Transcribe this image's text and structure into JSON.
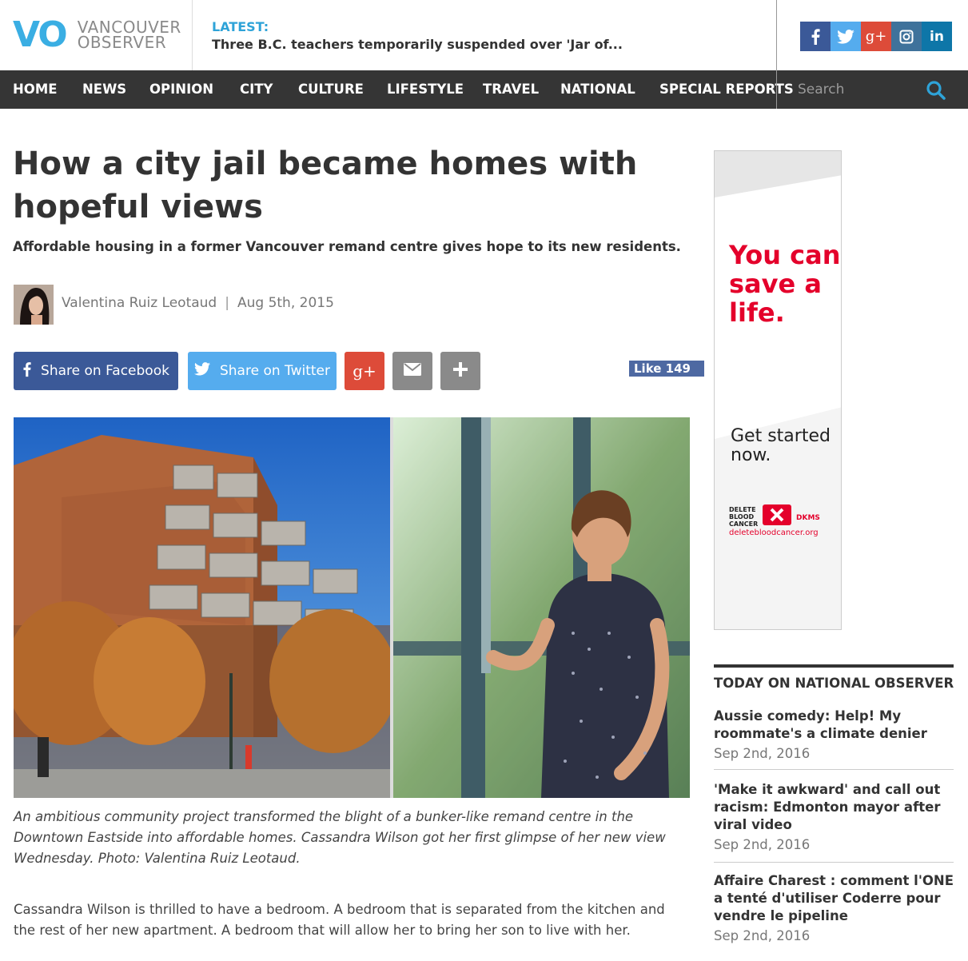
{
  "header": {
    "logo_mark": "VO",
    "logo_line1": "VANCOUVER",
    "logo_line2": "OBSERVER",
    "latest_label": "LATEST:",
    "latest_text": "Three B.C. teachers temporarily suspended over 'Jar of...",
    "social": [
      {
        "icon": "facebook-icon",
        "glyph": "f",
        "color": "#3b5998"
      },
      {
        "icon": "twitter-icon",
        "glyph": "t",
        "color": "#55acee"
      },
      {
        "icon": "google-plus-icon",
        "glyph": "g+",
        "color": "#dd4b39"
      },
      {
        "icon": "instagram-icon",
        "glyph": "◎",
        "color": "#3f729b"
      },
      {
        "icon": "linkedin-icon",
        "glyph": "in",
        "color": "#0e76a8"
      }
    ]
  },
  "nav": {
    "items": [
      "HOME",
      "NEWS",
      "OPINION",
      "CITY",
      "CULTURE",
      "LIFESTYLE",
      "TRAVEL",
      "NATIONAL",
      "SPECIAL REPORTS"
    ],
    "search_placeholder": "Search"
  },
  "article": {
    "headline": "How a city jail became homes with hopeful views",
    "dek": "Affordable housing in a former Vancouver remand centre gives hope to its new residents.",
    "author": "Valentina Ruiz Leotaud",
    "separator": "|",
    "date": "Aug 5th, 2015",
    "share_facebook": "Share on Facebook",
    "share_twitter": "Share on Twitter",
    "like_label": "Like 149",
    "caption": "An ambitious community project transformed the blight of a bunker-like remand centre in the Downtown Eastside into affordable homes. Cassandra Wilson got her first glimpse of her new view Wednesday. Photo: Valentina Ruiz Leotaud.",
    "body": "Cassandra Wilson is thrilled to have a bedroom. A bedroom that is separated from the kitchen and the rest of her new apartment. A bedroom that will allow her to bring her son to live with her."
  },
  "ad": {
    "headline": "You can save a life.",
    "sub": "Get started now.",
    "brand": "DELETE BLOOD CANCER",
    "dkms": "DKMS",
    "url": "deletebloodcancer.org"
  },
  "sidebar": {
    "title": "TODAY ON NATIONAL OBSERVER",
    "items": [
      {
        "title": "Aussie comedy: Help! My roommate's a climate denier",
        "date": "Sep 2nd, 2016"
      },
      {
        "title": "'Make it awkward' and call out racism: Edmonton mayor after viral video",
        "date": "Sep 2nd, 2016"
      },
      {
        "title": "Affaire Charest : comment l'ONE a tenté d'utiliser Coderre pour vendre le pipeline",
        "date": "Sep 2nd, 2016"
      }
    ]
  }
}
